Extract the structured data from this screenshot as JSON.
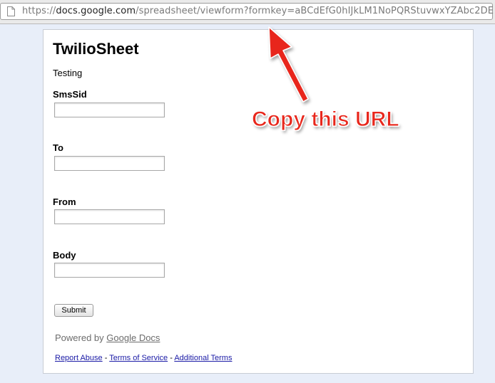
{
  "browser": {
    "url_scheme": "https://",
    "url_host": "docs.google.com",
    "url_path": "/spreadsheet/viewform?formkey=aBCdEfG0hIJkLM1NoPQRStuvwxYZAbc2DE",
    "page_icon": "document-icon"
  },
  "form": {
    "title": "TwilioSheet",
    "description": "Testing",
    "fields": [
      {
        "label": "SmsSid",
        "value": ""
      },
      {
        "label": "To",
        "value": ""
      },
      {
        "label": "From",
        "value": ""
      },
      {
        "label": "Body",
        "value": ""
      }
    ],
    "submit_label": "Submit"
  },
  "footer": {
    "powered_prefix": "Powered by",
    "powered_link": "Google Docs",
    "report_abuse": "Report Abuse",
    "separator": " - ",
    "terms": "Terms of Service",
    "additional_terms": "Additional Terms"
  },
  "annotation": {
    "text": "Copy this URL",
    "color": "#e8271c"
  }
}
